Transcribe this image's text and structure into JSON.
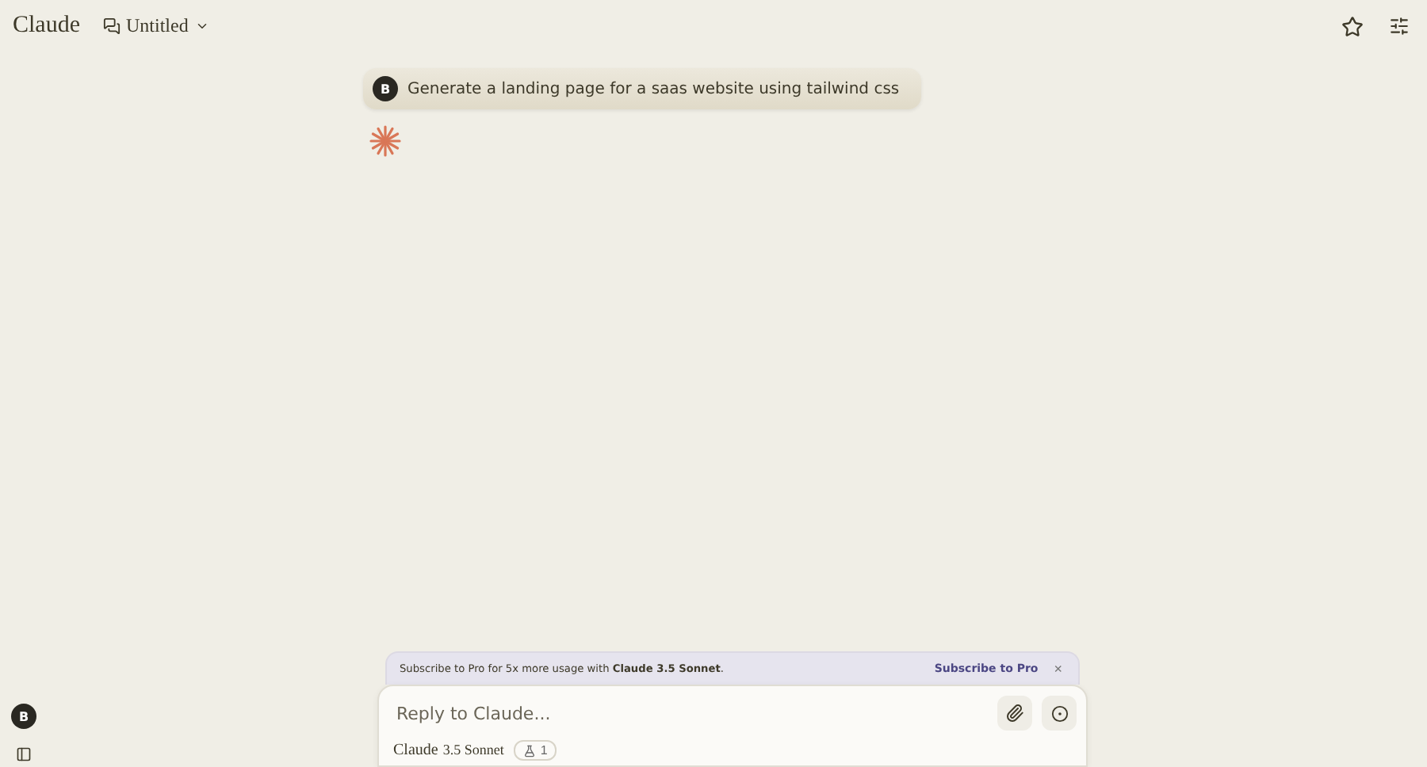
{
  "header": {
    "brand": "Claude",
    "chat_title": "Untitled"
  },
  "messages": [
    {
      "kind": "user",
      "avatar": "B",
      "text": "Generate a landing page for a saas website using tailwind css"
    },
    {
      "kind": "assistant_thinking"
    }
  ],
  "banner": {
    "text": "Subscribe to Pro for 5x more usage with **Claude 3.5 Sonnet**.",
    "action": "Subscribe to Pro",
    "close": "×"
  },
  "composer": {
    "placeholder": "Reply to Claude...",
    "model_name": "Claude",
    "model_version": "3.5 Sonnet",
    "count": "1"
  },
  "sidebar": {
    "avatar": "B"
  }
}
